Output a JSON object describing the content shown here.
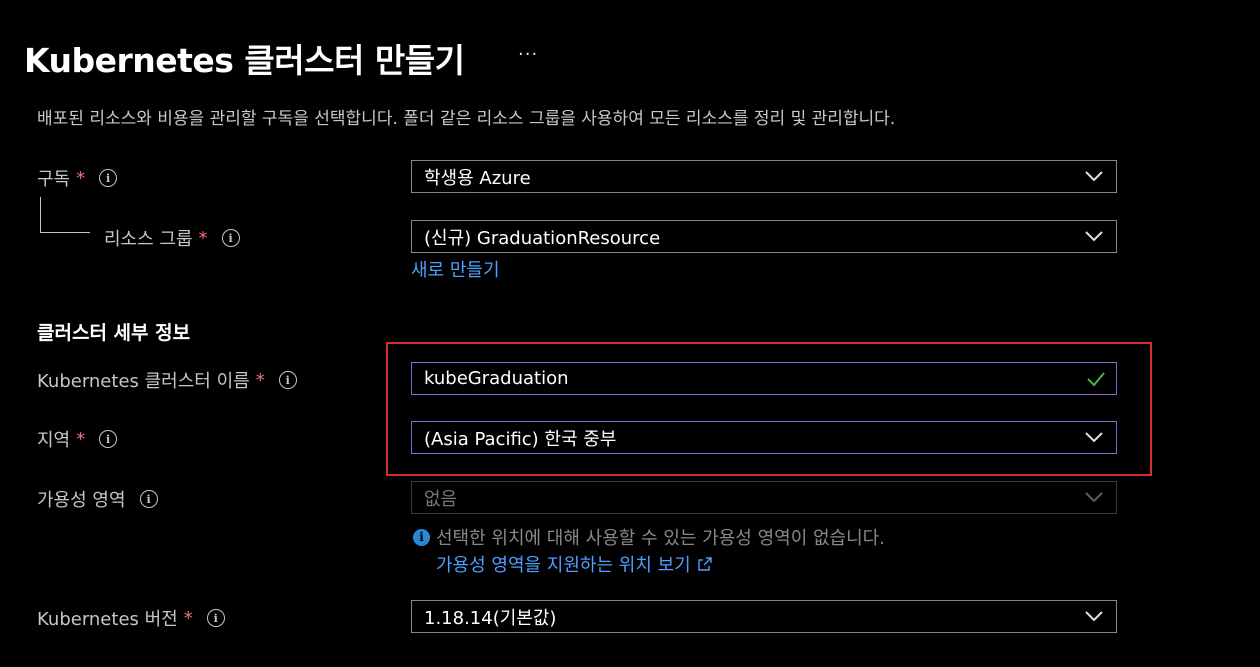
{
  "header": {
    "title": "Kubernetes 클러스터 만들기",
    "more_label": "···"
  },
  "intro_text": "배포된 리소스와 비용을 관리할 구독을 선택합니다. 폴더 같은 리소스 그룹을 사용하여 모든 리소스를 정리 및 관리합니다.",
  "subscription": {
    "label": "구독",
    "required": "*",
    "value": "학생용 Azure"
  },
  "resource_group": {
    "label": "리소스 그룹",
    "required": "*",
    "value": "(신규) GraduationResource",
    "create_new": "새로 만들기"
  },
  "cluster_details": {
    "heading": "클러스터 세부 정보",
    "name": {
      "label": "Kubernetes 클러스터 이름",
      "required": "*",
      "value": "kubeGraduation"
    },
    "region": {
      "label": "지역",
      "required": "*",
      "value": "(Asia Pacific) 한국 중부"
    },
    "availability": {
      "label": "가용성 영역",
      "value": "없음",
      "note": "선택한 위치에 대해 사용할 수 있는 가용성 영역이 없습니다.",
      "link": "가용성 영역을 지원하는 위치 보기"
    },
    "version": {
      "label": "Kubernetes 버전",
      "required": "*",
      "value": "1.18.14(기본값)"
    }
  },
  "colors": {
    "link": "#4f9fff",
    "required": "#f1707b",
    "focus_border": "#8a62c9",
    "highlight": "#d32f2f",
    "valid": "#3fb950"
  }
}
